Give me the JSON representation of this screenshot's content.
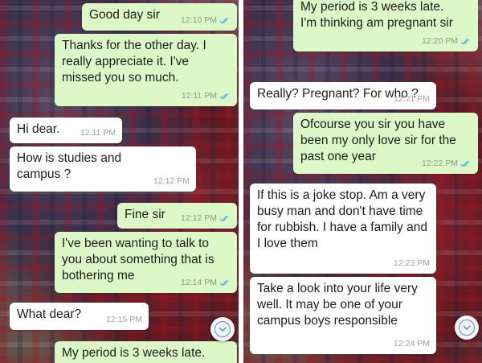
{
  "left_chat": {
    "messages": [
      {
        "dir": "out",
        "text": "Good day sir",
        "time": "12:10 PM",
        "ticks": true
      },
      {
        "dir": "out",
        "text": "Thanks for the other day. I really appreciate it. I've missed you so much.",
        "time": "12:11 PM",
        "ticks": true
      },
      {
        "dir": "in",
        "text": "Hi dear.",
        "time": "12:11 PM",
        "ticks": false
      },
      {
        "dir": "in",
        "text": "How is studies and campus ?",
        "time": "12:12 PM",
        "ticks": false
      },
      {
        "dir": "out",
        "text": "Fine sir",
        "time": "12:12 PM",
        "ticks": true
      },
      {
        "dir": "out",
        "text": "I've been wanting to talk to you about something that is bothering me",
        "time": "12:14 PM",
        "ticks": true
      },
      {
        "dir": "in",
        "text": "What dear?",
        "time": "12:15 PM",
        "ticks": false
      },
      {
        "dir": "out",
        "text": "My period is 3 weeks late.",
        "time": "",
        "ticks": false
      }
    ]
  },
  "right_chat": {
    "messages": [
      {
        "dir": "out",
        "text": "My period is 3 weeks late. I'm thinking am pregnant sir",
        "time": "12:20 PM",
        "ticks": true
      },
      {
        "dir": "in",
        "text": "Really? Pregnant? For who ?",
        "time": "12:21 PM",
        "ticks": false
      },
      {
        "dir": "out",
        "text": "Ofcourse you sir you have been my only love sir for the past one year",
        "time": "12:22 PM",
        "ticks": true
      },
      {
        "dir": "in",
        "text": "If this is a joke stop. Am a very busy man and don't have time for rubbish. I have a family and I love them",
        "time": "12:23 PM",
        "ticks": false
      },
      {
        "dir": "in",
        "text": "Take a look into your life very well. It may be one of your campus boys responsible",
        "time": "12:24 PM",
        "ticks": false
      }
    ]
  },
  "icons": {
    "scroll_down": "chevron-down-circle-icon",
    "read_receipt": "double-check-icon"
  },
  "colors": {
    "outgoing": "#dcf8c6",
    "incoming": "#ffffff",
    "tick": "#4fb6ec"
  }
}
